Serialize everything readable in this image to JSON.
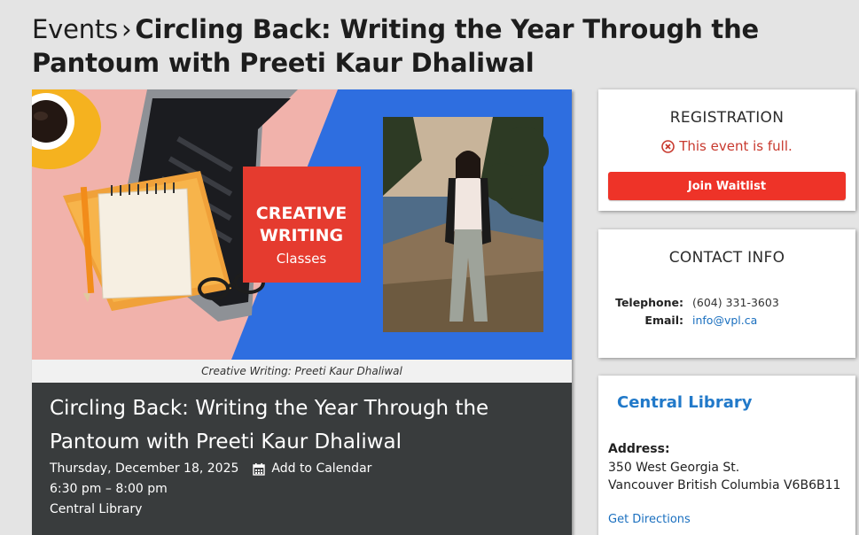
{
  "page": {
    "breadcrumb": "Events",
    "separator": "›",
    "title": "Circling Back: Writing the Year Through the Pantoum with Preeti Kaur Dhaliwal"
  },
  "hero": {
    "badge_line1": "CREATIVE",
    "badge_line2": "WRITING",
    "badge_line3": "Classes",
    "caption": "Creative Writing: Preeti Kaur Dhaliwal",
    "colors": {
      "blue": "#2e6ee0",
      "pink": "#f1b2ab",
      "badge_red": "#e53b2f"
    }
  },
  "event": {
    "title": "Circling Back: Writing the Year Through the Pantoum with Preeti Kaur Dhaliwal",
    "date": "Thursday, December 18, 2025",
    "add_to_calendar": "Add to Calendar",
    "time": "6:30 pm – 8:00 pm",
    "location": "Central Library"
  },
  "registration": {
    "heading": "REGISTRATION",
    "status": "This event is full.",
    "button": "Join Waitlist",
    "accent": "#ee3328"
  },
  "contact": {
    "heading": "CONTACT INFO",
    "telephone_label": "Telephone:",
    "telephone": "(604) 331-3603",
    "email_label": "Email:",
    "email": "info@vpl.ca"
  },
  "branch": {
    "name": "Central Library",
    "address_label": "Address:",
    "address_line1": "350 West Georgia St.",
    "address_line2": "Vancouver British Columbia V6B6B11",
    "directions": "Get Directions",
    "link_color": "#2179c9"
  }
}
